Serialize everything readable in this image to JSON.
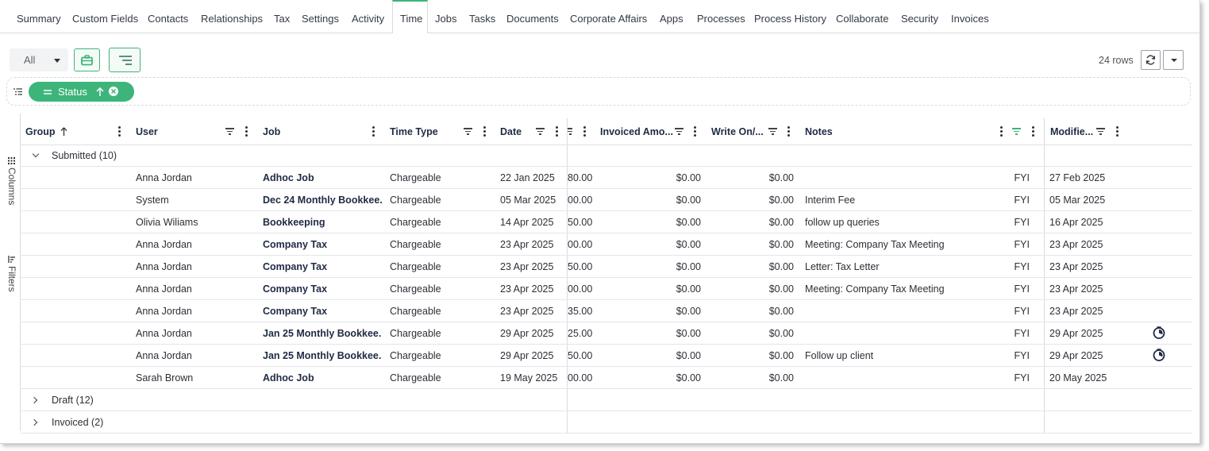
{
  "tabs": [
    {
      "label": "Summary",
      "active": false
    },
    {
      "label": "Custom Fields",
      "active": false
    },
    {
      "label": "Contacts",
      "active": false
    },
    {
      "label": "Relationships",
      "active": false
    },
    {
      "label": "Tax",
      "active": false
    },
    {
      "label": "Settings",
      "active": false
    },
    {
      "label": "Activity",
      "active": false
    },
    {
      "label": "Time",
      "active": true
    },
    {
      "label": "Jobs",
      "active": false
    },
    {
      "label": "Tasks",
      "active": false
    },
    {
      "label": "Documents",
      "active": false
    },
    {
      "label": "Corporate Affairs",
      "active": false
    },
    {
      "label": "Apps",
      "active": false
    },
    {
      "label": "Processes",
      "active": false
    },
    {
      "label": "Process History",
      "active": false
    },
    {
      "label": "Collaborate",
      "active": false
    },
    {
      "label": "Security",
      "active": false
    },
    {
      "label": "Invoices",
      "active": false
    }
  ],
  "toolbar": {
    "filter_value": "All",
    "rows_count": "24 rows",
    "accent_color": "#3db57a"
  },
  "grouping": {
    "chip_label": "Status",
    "sort": "ascending"
  },
  "side_panel": {
    "columns_label": "Columns",
    "filters_label": "Filters"
  },
  "columns": {
    "group": "Group",
    "user": "User",
    "job": "Job",
    "time_type": "Time Type",
    "date": "Date",
    "invoiced_amount": "Invoiced Amo...",
    "write_on": "Write On/...",
    "notes": "Notes",
    "modified": "Modifie..."
  },
  "groups": [
    {
      "label": "Submitted",
      "count": "(10)",
      "expanded": true,
      "rows": [
        {
          "user": "Anna Jordan",
          "job": "Adhoc Job",
          "time_type": "Chargeable",
          "date": "22 Jan 2025",
          "amount": "80.00",
          "invoiced": "$0.00",
          "write_on": "$0.00",
          "notes": "",
          "fyi": "FYI",
          "modified": "27 Feb 2025",
          "icon": false
        },
        {
          "user": "System",
          "job": "Dec 24 Monthly Bookkee...",
          "time_type": "Chargeable",
          "date": "05 Mar 2025",
          "amount": "00.00",
          "invoiced": "$0.00",
          "write_on": "$0.00",
          "notes": "Interim Fee",
          "fyi": "FYI",
          "modified": "05 Mar 2025",
          "icon": false
        },
        {
          "user": "Olivia Wiliams",
          "job": "Bookkeeping",
          "time_type": "Chargeable",
          "date": "14 Apr 2025",
          "amount": "50.00",
          "invoiced": "$0.00",
          "write_on": "$0.00",
          "notes": "follow up queries",
          "fyi": "FYI",
          "modified": "16 Apr 2025",
          "icon": false
        },
        {
          "user": "Anna Jordan",
          "job": "Company Tax",
          "time_type": "Chargeable",
          "date": "23 Apr 2025",
          "amount": "00.00",
          "invoiced": "$0.00",
          "write_on": "$0.00",
          "notes": "Meeting: Company Tax Meeting",
          "fyi": "FYI",
          "modified": "23 Apr 2025",
          "icon": false
        },
        {
          "user": "Anna Jordan",
          "job": "Company Tax",
          "time_type": "Chargeable",
          "date": "23 Apr 2025",
          "amount": "50.00",
          "invoiced": "$0.00",
          "write_on": "$0.00",
          "notes": "Letter: Tax Letter",
          "fyi": "FYI",
          "modified": "23 Apr 2025",
          "icon": false
        },
        {
          "user": "Anna Jordan",
          "job": "Company Tax",
          "time_type": "Chargeable",
          "date": "23 Apr 2025",
          "amount": "00.00",
          "invoiced": "$0.00",
          "write_on": "$0.00",
          "notes": "Meeting: Company Tax Meeting",
          "fyi": "FYI",
          "modified": "23 Apr 2025",
          "icon": false
        },
        {
          "user": "Anna Jordan",
          "job": "Company Tax",
          "time_type": "Chargeable",
          "date": "23 Apr 2025",
          "amount": "35.00",
          "invoiced": "$0.00",
          "write_on": "$0.00",
          "notes": "",
          "fyi": "FYI",
          "modified": "23 Apr 2025",
          "icon": false
        },
        {
          "user": "Anna Jordan",
          "job": "Jan 25 Monthly Bookkee...",
          "time_type": "Chargeable",
          "date": "29 Apr 2025",
          "amount": "25.00",
          "invoiced": "$0.00",
          "write_on": "$0.00",
          "notes": "",
          "fyi": "FYI",
          "modified": "29 Apr 2025",
          "icon": true
        },
        {
          "user": "Anna Jordan",
          "job": "Jan 25 Monthly Bookkee...",
          "time_type": "Chargeable",
          "date": "29 Apr 2025",
          "amount": "50.00",
          "invoiced": "$0.00",
          "write_on": "$0.00",
          "notes": "Follow up client",
          "fyi": "FYI",
          "modified": "29 Apr 2025",
          "icon": true
        },
        {
          "user": "Sarah Brown",
          "job": "Adhoc Job",
          "time_type": "Chargeable",
          "date": "19 May 2025",
          "amount": "00.00",
          "invoiced": "$0.00",
          "write_on": "$0.00",
          "notes": "",
          "fyi": "FYI",
          "modified": "20 May 2025",
          "icon": false
        }
      ]
    },
    {
      "label": "Draft",
      "count": "(12)",
      "expanded": false,
      "rows": []
    },
    {
      "label": "Invoiced",
      "count": "(2)",
      "expanded": false,
      "rows": []
    }
  ]
}
